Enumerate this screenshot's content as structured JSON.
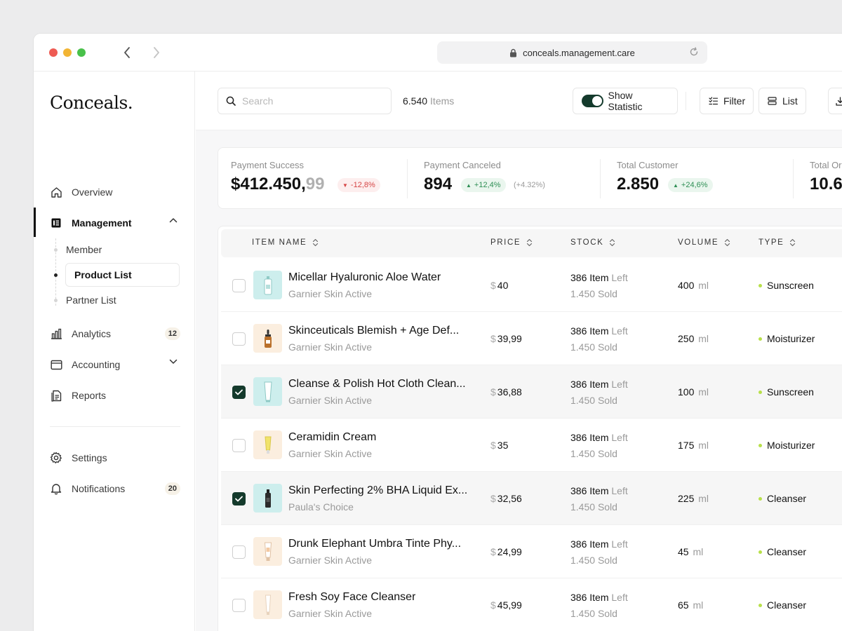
{
  "browser": {
    "url": "conceals.management.care"
  },
  "sidebar": {
    "logo": "Conceals.",
    "items": [
      {
        "label": "Overview",
        "icon": "home-icon"
      },
      {
        "label": "Management",
        "icon": "document-icon",
        "expanded": true
      },
      {
        "label": "Analytics",
        "icon": "bar-chart-icon",
        "badge": "12"
      },
      {
        "label": "Accounting",
        "icon": "wallet-icon"
      },
      {
        "label": "Reports",
        "icon": "report-icon"
      }
    ],
    "management_sub": [
      "Member",
      "Product List",
      "Partner List"
    ],
    "bottom": [
      {
        "label": "Settings",
        "icon": "gear-icon"
      },
      {
        "label": "Notifications",
        "icon": "bell-icon",
        "badge": "20"
      }
    ]
  },
  "toolbar": {
    "search_placeholder": "Search",
    "items_count": "6.540",
    "items_label": "Items",
    "show_statistic": "Show Statistic",
    "show_statistic_on": true,
    "filter": "Filter",
    "list": "List"
  },
  "stats": [
    {
      "label": "Payment Success",
      "value": "$412.450,",
      "cents": "99",
      "change": "-12,8%",
      "direction": "down"
    },
    {
      "label": "Payment Canceled",
      "value": "894",
      "change": "+12,4%",
      "direction": "up",
      "extra": "(+4.32%)"
    },
    {
      "label": "Total Customer",
      "value": "2.850",
      "change": "+24,6%",
      "direction": "up"
    },
    {
      "label": "Total Or",
      "value": "10.6"
    }
  ],
  "table": {
    "headers": {
      "name": "ITEM NAME",
      "price": "PRICE",
      "stock": "STOCK",
      "volume": "VOLUME",
      "type": "TYPE"
    },
    "currency": "$",
    "item_word": "Item",
    "left_word": "Left",
    "sold_word": "Sold",
    "unit": "ml",
    "rows": [
      {
        "name": "Micellar Hyaluronic Aloe Water",
        "brand": "Garnier Skin Active",
        "price": "40",
        "stock": "386",
        "sold": "1.450",
        "volume": "400",
        "type": "Sunscreen",
        "checked": false
      },
      {
        "name": "Skinceuticals Blemish + Age Def...",
        "brand": "Garnier Skin Active",
        "price": "39,99",
        "stock": "386",
        "sold": "1.450",
        "volume": "250",
        "type": "Moisturizer",
        "checked": false
      },
      {
        "name": "Cleanse & Polish Hot Cloth Clean...",
        "brand": "Garnier Skin Active",
        "price": "36,88",
        "stock": "386",
        "sold": "1.450",
        "volume": "100",
        "type": "Sunscreen",
        "checked": true
      },
      {
        "name": "Ceramidin Cream",
        "brand": "Garnier Skin Active",
        "price": "35",
        "stock": "386",
        "sold": "1.450",
        "volume": "175",
        "type": "Moisturizer",
        "checked": false
      },
      {
        "name": "Skin Perfecting 2% BHA Liquid Ex...",
        "brand": "Paula's Choice",
        "price": "32,56",
        "stock": "386",
        "sold": "1.450",
        "volume": "225",
        "type": "Cleanser",
        "checked": true
      },
      {
        "name": "Drunk Elephant Umbra Tinte Phy...",
        "brand": "Garnier Skin Active",
        "price": "24,99",
        "stock": "386",
        "sold": "1.450",
        "volume": "45",
        "type": "Cleanser",
        "checked": false
      },
      {
        "name": "Fresh Soy Face Cleanser",
        "brand": "Garnier Skin Active",
        "price": "45,99",
        "stock": "386",
        "sold": "1.450",
        "volume": "65",
        "type": "Cleanser",
        "checked": false
      }
    ]
  },
  "colors": {
    "accent": "#143a2c",
    "type_dot": "#b8e04a",
    "thumb_teal": "#cdeeed",
    "thumb_cream": "#fbeedf"
  }
}
